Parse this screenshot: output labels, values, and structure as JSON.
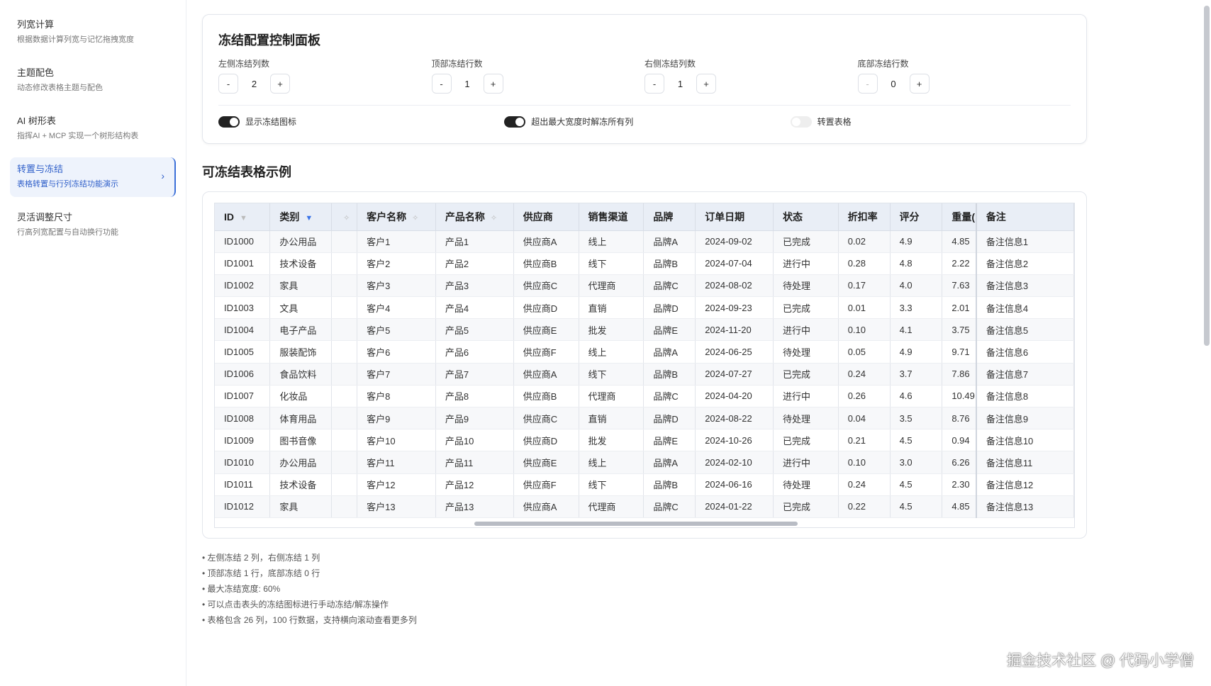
{
  "sidebar": {
    "items": [
      {
        "title": "列宽计算",
        "desc": "根据数据计算列宽与记忆拖拽宽度"
      },
      {
        "title": "主题配色",
        "desc": "动态修改表格主题与配色"
      },
      {
        "title": "AI 树形表",
        "desc": "指挥AI + MCP 实现一个树形结构表"
      },
      {
        "title": "转置与冻结",
        "desc": "表格转置与行列冻结功能演示",
        "active": true
      },
      {
        "title": "灵活调整尺寸",
        "desc": "行高列宽配置与自动换行功能"
      }
    ]
  },
  "panel": {
    "title": "冻结配置控制面板",
    "controls": [
      {
        "label": "左侧冻结列数",
        "value": "2"
      },
      {
        "label": "顶部冻结行数",
        "value": "1"
      },
      {
        "label": "右侧冻结列数",
        "value": "1"
      },
      {
        "label": "底部冻结行数",
        "value": "0"
      }
    ],
    "minus": "-",
    "plus": "+",
    "toggles": [
      {
        "label": "显示冻结图标",
        "on": true
      },
      {
        "label": "超出最大宽度时解冻所有列",
        "on": true
      },
      {
        "label": "转置表格",
        "on": false
      }
    ]
  },
  "section_title": "可冻结表格示例",
  "table": {
    "columns": [
      "ID",
      "类别",
      "",
      "客户名称",
      "产品名称",
      "供应商",
      "销售渠道",
      "品牌",
      "订单日期",
      "状态",
      "折扣率",
      "评分",
      "重量(",
      "备注"
    ],
    "rows": [
      [
        "ID1000",
        "办公用品",
        "",
        "客户1",
        "产品1",
        "供应商A",
        "线上",
        "品牌A",
        "2024-09-02",
        "已完成",
        "0.02",
        "4.9",
        "4.85",
        "备注信息1"
      ],
      [
        "ID1001",
        "技术设备",
        "",
        "客户2",
        "产品2",
        "供应商B",
        "线下",
        "品牌B",
        "2024-07-04",
        "进行中",
        "0.28",
        "4.8",
        "2.22",
        "备注信息2"
      ],
      [
        "ID1002",
        "家具",
        "",
        "客户3",
        "产品3",
        "供应商C",
        "代理商",
        "品牌C",
        "2024-08-02",
        "待处理",
        "0.17",
        "4.0",
        "7.63",
        "备注信息3"
      ],
      [
        "ID1003",
        "文具",
        "",
        "客户4",
        "产品4",
        "供应商D",
        "直销",
        "品牌D",
        "2024-09-23",
        "已完成",
        "0.01",
        "3.3",
        "2.01",
        "备注信息4"
      ],
      [
        "ID1004",
        "电子产品",
        "",
        "客户5",
        "产品5",
        "供应商E",
        "批发",
        "品牌E",
        "2024-11-20",
        "进行中",
        "0.10",
        "4.1",
        "3.75",
        "备注信息5"
      ],
      [
        "ID1005",
        "服装配饰",
        "",
        "客户6",
        "产品6",
        "供应商F",
        "线上",
        "品牌A",
        "2024-06-25",
        "待处理",
        "0.05",
        "4.9",
        "9.71",
        "备注信息6"
      ],
      [
        "ID1006",
        "食品饮料",
        "",
        "客户7",
        "产品7",
        "供应商A",
        "线下",
        "品牌B",
        "2024-07-27",
        "已完成",
        "0.24",
        "3.7",
        "7.86",
        "备注信息7"
      ],
      [
        "ID1007",
        "化妆品",
        "",
        "客户8",
        "产品8",
        "供应商B",
        "代理商",
        "品牌C",
        "2024-04-20",
        "进行中",
        "0.26",
        "4.6",
        "10.49",
        "备注信息8"
      ],
      [
        "ID1008",
        "体育用品",
        "",
        "客户9",
        "产品9",
        "供应商C",
        "直销",
        "品牌D",
        "2024-08-22",
        "待处理",
        "0.04",
        "3.5",
        "8.76",
        "备注信息9"
      ],
      [
        "ID1009",
        "图书音像",
        "",
        "客户10",
        "产品10",
        "供应商D",
        "批发",
        "品牌E",
        "2024-10-26",
        "已完成",
        "0.21",
        "4.5",
        "0.94",
        "备注信息10"
      ],
      [
        "ID1010",
        "办公用品",
        "",
        "客户11",
        "产品11",
        "供应商E",
        "线上",
        "品牌A",
        "2024-02-10",
        "进行中",
        "0.10",
        "3.0",
        "6.26",
        "备注信息11"
      ],
      [
        "ID1011",
        "技术设备",
        "",
        "客户12",
        "产品12",
        "供应商F",
        "线下",
        "品牌B",
        "2024-06-16",
        "待处理",
        "0.24",
        "4.5",
        "2.30",
        "备注信息12"
      ],
      [
        "ID1012",
        "家具",
        "",
        "客户13",
        "产品13",
        "供应商A",
        "代理商",
        "品牌C",
        "2024-01-22",
        "已完成",
        "0.22",
        "4.5",
        "4.85",
        "备注信息13"
      ]
    ]
  },
  "notes": [
    "• 左侧冻结 2 列，右侧冻结 1 列",
    "• 顶部冻结 1 行，底部冻结 0 行",
    "• 最大冻结宽度: 60%",
    "• 可以点击表头的冻结图标进行手动冻结/解冻操作",
    "• 表格包含 26 列，100 行数据，支持横向滚动查看更多列"
  ],
  "watermark": "掘金技术社区 @ 代码小学僧"
}
